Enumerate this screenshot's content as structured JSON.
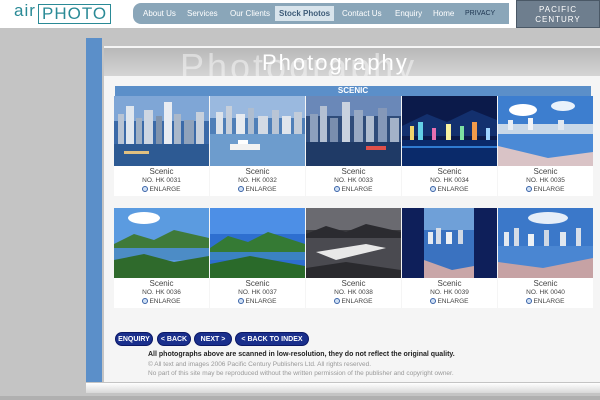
{
  "logo": {
    "air": "air",
    "photo": "PHOTO"
  },
  "nav": [
    {
      "label": "About Us",
      "active": false
    },
    {
      "label": "Services",
      "active": false
    },
    {
      "label": "Our Clients",
      "active": false
    },
    {
      "label": "Stock Photos",
      "active": true
    },
    {
      "label": "Contact Us",
      "active": false
    },
    {
      "label": "Enquiry",
      "active": false
    },
    {
      "label": "Home",
      "active": false
    },
    {
      "label": "PRIVACY",
      "active": false
    }
  ],
  "brand": {
    "line1": "PACIFIC",
    "line2": "CENTURY"
  },
  "banner": {
    "ghost": "Photography",
    "title": "Photography"
  },
  "section_title": "SCENIC",
  "enlarge_label": "ENLARGE",
  "photos": [
    {
      "title": "Scenic",
      "no": "NO. HK 0031"
    },
    {
      "title": "Scenic",
      "no": "NO. HK 0032"
    },
    {
      "title": "Scenic",
      "no": "NO. HK 0033"
    },
    {
      "title": "Scenic",
      "no": "NO. HK 0034"
    },
    {
      "title": "Scenic",
      "no": "NO. HK 0035"
    },
    {
      "title": "Scenic",
      "no": "NO. HK 0036"
    },
    {
      "title": "Scenic",
      "no": "NO. HK 0037"
    },
    {
      "title": "Scenic",
      "no": "NO. HK 0038"
    },
    {
      "title": "Scenic",
      "no": "NO. HK 0039"
    },
    {
      "title": "Scenic",
      "no": "NO. HK 0040"
    }
  ],
  "buttons": {
    "enquiry": "ENQUIRY",
    "back": "< BACK",
    "next": "NEXT >",
    "back_index": "< BACK TO INDEX"
  },
  "notice": "All photographs above are scanned in low-resolution, they do not reflect the original quality.",
  "copyright1": "© All text and images 2006 Pacific Century Publishers Ltd. All rights reserved.",
  "copyright2": "No part of this site may be reproduced without the written permission of the publisher and copyright owner."
}
